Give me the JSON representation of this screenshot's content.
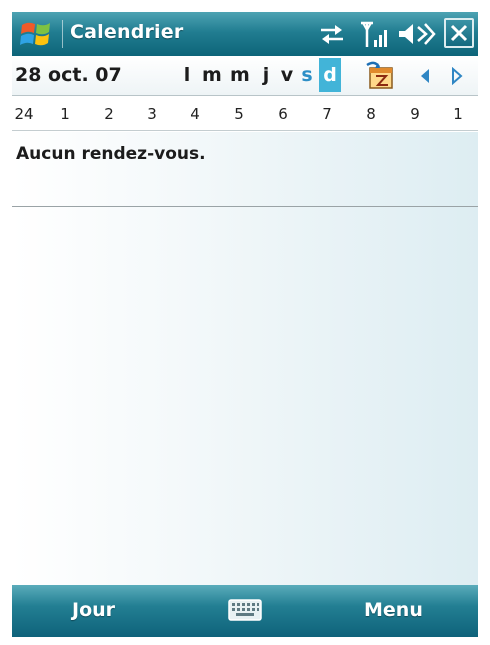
{
  "title_bar": {
    "app_title": "Calendrier",
    "icons": [
      "windows-start-icon",
      "sync-arrows-icon",
      "signal-strength-icon",
      "speaker-icon",
      "close-icon"
    ]
  },
  "date_bar": {
    "date": "28 oct. 07",
    "weekdays": [
      "l",
      "m",
      "m",
      "j",
      "v",
      "s",
      "d"
    ],
    "selected_weekday": "d",
    "icons": [
      "go-to-today-icon",
      "previous-arrow-icon",
      "next-arrow-icon"
    ]
  },
  "hours_ruler": {
    "hours": [
      "24",
      "1",
      "2",
      "3",
      "4",
      "5",
      "6",
      "7",
      "8",
      "9",
      "1"
    ]
  },
  "agenda": {
    "empty_message": "Aucun rendez-vous."
  },
  "softkeys": {
    "left": "Jour",
    "right": "Menu",
    "center_icon": "keyboard-icon"
  },
  "colors": {
    "title_bar": "#217d91",
    "weekend_text": "#2d8fc6",
    "selected_day_bg": "#42b4d8"
  }
}
